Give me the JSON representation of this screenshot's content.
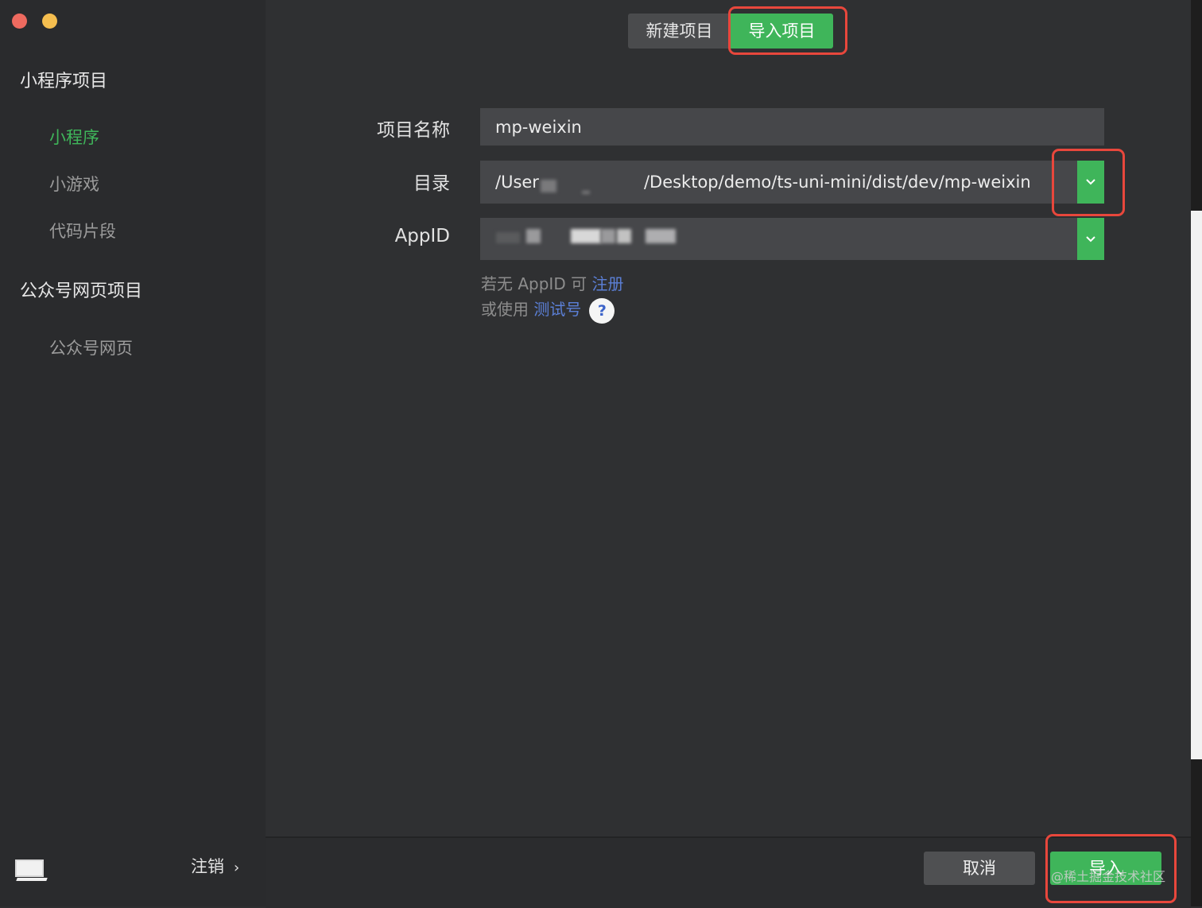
{
  "sidebar": {
    "miniprogram_group": "小程序项目",
    "miniprogram_items": [
      "小程序",
      "小游戏",
      "代码片段"
    ],
    "official_group": "公众号网页项目",
    "official_items": [
      "公众号网页"
    ],
    "logout_label": "注销",
    "logout_chevron": "›"
  },
  "tabs": {
    "new_project": "新建项目",
    "import_project": "导入项目",
    "active": "import_project"
  },
  "form": {
    "name_label": "项目名称",
    "name_value": "mp-weixin",
    "dir_label": "目录",
    "dir_value_prefix": "/User",
    "dir_value_suffix": "/Desktop/demo/ts-uni-mini/dist/dev/mp-weixin",
    "appid_label": "AppID"
  },
  "hints": {
    "no_appid_prefix": "若无 AppID 可 ",
    "register_link": "注册",
    "or_use_prefix": "或使用 ",
    "test_account_link": "测试号",
    "help_icon": "?"
  },
  "footer": {
    "cancel": "取消",
    "import": "导入",
    "watermark": "@稀土掘金技术社区"
  },
  "colors": {
    "accent": "#3fb55a",
    "link": "#5b7fd6",
    "highlight": "#e8473c"
  }
}
